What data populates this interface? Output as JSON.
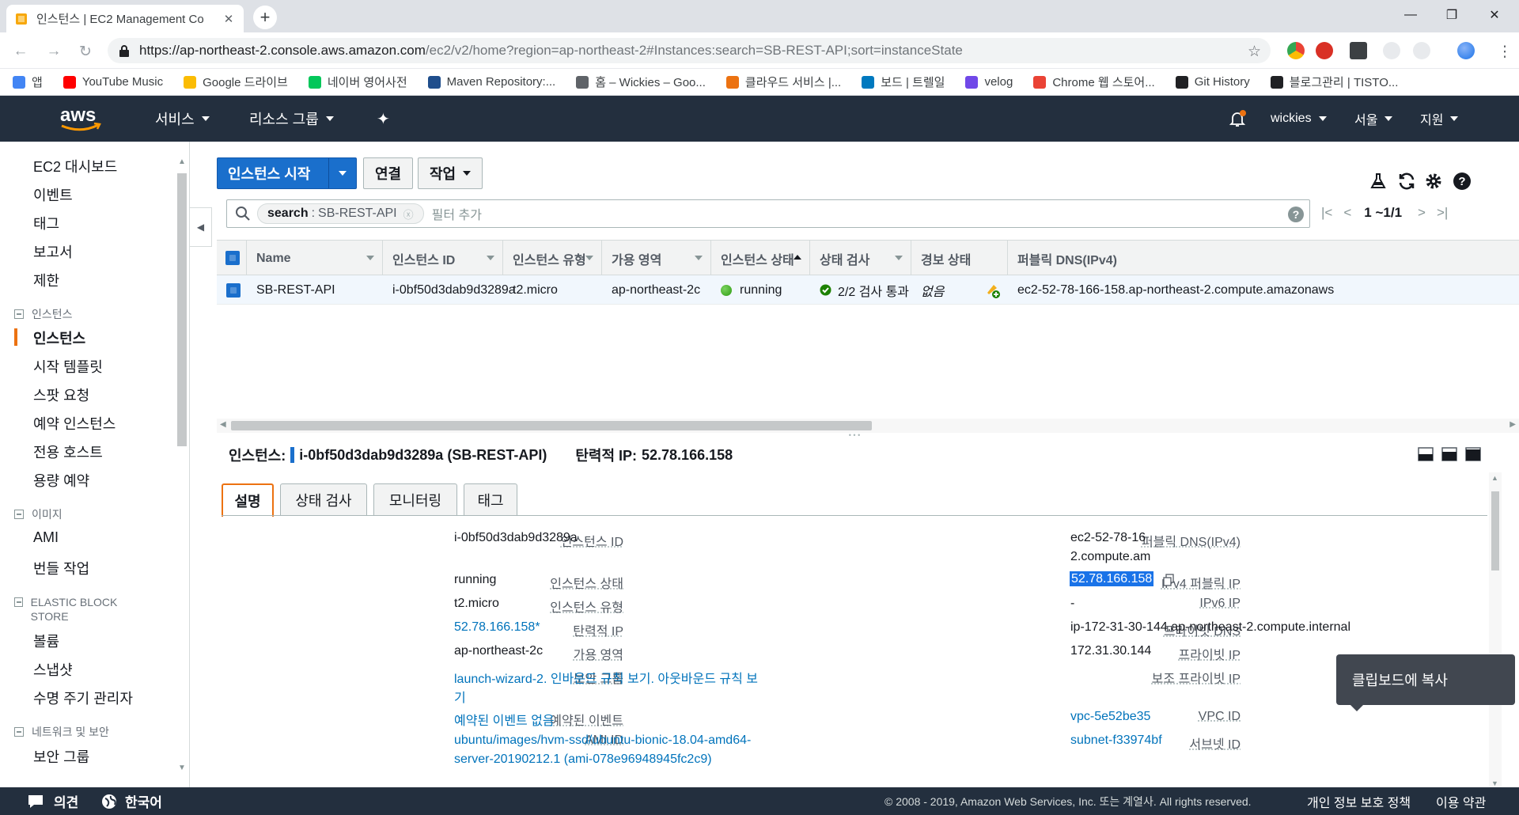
{
  "browser": {
    "tab_title": "인스턴스 | EC2 Management Co",
    "url_host": "https://ap-northeast-2.console.aws.amazon.com",
    "url_path": "/ec2/v2/home?region=ap-northeast-2#Instances:search=SB-REST-API;sort=instanceState",
    "bookmarks": [
      {
        "label": "앱",
        "icon": "apps-grid-icon",
        "color": "#4285f4"
      },
      {
        "label": "YouTube Music",
        "icon": "youtube-music-icon",
        "color": "#ff0000"
      },
      {
        "label": "Google 드라이브",
        "icon": "google-drive-icon",
        "color": "#fbbc04"
      },
      {
        "label": "네이버 영어사전",
        "icon": "naver-dictionary-icon",
        "color": "#03c75a"
      },
      {
        "label": "Maven Repository:...",
        "icon": "maven-icon",
        "color": "#1f4e8c"
      },
      {
        "label": "홈 – Wickies – Goo...",
        "icon": "gear-site-icon",
        "color": "#5f6368"
      },
      {
        "label": "클라우드 서비스 |...",
        "icon": "aws-cube-icon",
        "color": "#ec7211"
      },
      {
        "label": "보드 | 트렐일",
        "icon": "trello-icon",
        "color": "#0079bf"
      },
      {
        "label": "velog",
        "icon": "velog-icon",
        "color": "#7048e8"
      },
      {
        "label": "Chrome 웹 스토어...",
        "icon": "chrome-webstore-icon",
        "color": "#ea4335"
      },
      {
        "label": "Git History",
        "icon": "git-history-icon",
        "color": "#202124"
      },
      {
        "label": "블로그관리 | TISTO...",
        "icon": "tistory-icon",
        "color": "#202124"
      }
    ]
  },
  "aws_header": {
    "logo": "aws",
    "services": "서비스",
    "resource_groups": "리소스 그룹",
    "user": "wickies",
    "region": "서울",
    "support": "지원"
  },
  "sidebar": {
    "items_top": [
      "EC2 대시보드",
      "이벤트",
      "태그",
      "보고서",
      "제한"
    ],
    "section_instances": "인스턴스",
    "items_instances": [
      "인스턴스",
      "시작 템플릿",
      "스팟 요청",
      "예약 인스턴스",
      "전용 호스트",
      "용량 예약"
    ],
    "section_images": "이미지",
    "items_images": [
      "AMI",
      "번들 작업"
    ],
    "section_ebs": "ELASTIC BLOCK STORE",
    "items_ebs": [
      "볼륨",
      "스냅샷",
      "수명 주기 관리자"
    ],
    "section_network": "네트워크 및 보안",
    "items_network": [
      "보안 그룹"
    ]
  },
  "toolbar": {
    "launch": "인스턴스 시작",
    "connect": "연결",
    "actions": "작업"
  },
  "filter": {
    "pill_key": "search",
    "pill_value": "SB-REST-API",
    "placeholder": "필터 추가",
    "page": "1 ~1/1"
  },
  "grid": {
    "columns": [
      "Name",
      "인스턴스 ID",
      "인스턴스 유형",
      "가용 영역",
      "인스턴스 상태",
      "상태 검사",
      "경보 상태",
      "퍼블릭 DNS(IPv4)"
    ],
    "row": {
      "name": "SB-REST-API",
      "id": "i-0bf50d3dab9d3289a",
      "type": "t2.micro",
      "az": "ap-northeast-2c",
      "state": "running",
      "checks": "2/2 검사 통과",
      "alarm": "없음",
      "dns": "ec2-52-78-166-158.ap-northeast-2.compute.amazonaws"
    }
  },
  "detail": {
    "label": "인스턴스:",
    "title": "i-0bf50d3dab9d3289a (SB-REST-API)",
    "eip_label": "탄력적 IP:",
    "eip_value": "52.78.166.158",
    "tabs": [
      "설명",
      "상태 검사",
      "모니터링",
      "태그"
    ],
    "left": [
      {
        "k": "인스턴스 ID",
        "v": "i-0bf50d3dab9d3289a"
      },
      {
        "k": "인스턴스 상태",
        "v": "running"
      },
      {
        "k": "인스턴스 유형",
        "v": "t2.micro"
      },
      {
        "k": "탄력적 IP",
        "v": "52.78.166.158*"
      },
      {
        "k": "가용 영역",
        "v": "ap-northeast-2c"
      },
      {
        "k": "보안 그룹",
        "v": "launch-wizard-2. 인바운드 규칙 보기. 아웃바운드 규칙 보",
        "v2": "기"
      },
      {
        "k": "예약된 이벤트",
        "v": "예약된 이벤트 없음"
      },
      {
        "k": "AMI ID",
        "v": "ubuntu/images/hvm-ssd/ubuntu-bionic-18.04-amd64-",
        "v2": "server-20190212.1 (ami-078e96948945fc2c9)"
      }
    ],
    "right": [
      {
        "k": "퍼블릭 DNS(IPv4)",
        "v": "ec2-52-78-16",
        "v2": "2.compute.am"
      },
      {
        "k": "IPv4 퍼블릭 IP",
        "v": "52.78.166.158"
      },
      {
        "k": "IPv6 IP",
        "v": "-"
      },
      {
        "k": "프라이빗 DNS",
        "v": "ip-172-31-30-144.ap-northeast-2.compute.internal"
      },
      {
        "k": "프라이빗 IP",
        "v": "172.31.30.144"
      },
      {
        "k": "보조 프라이빗 IP",
        "v": ""
      },
      {
        "k": "VPC ID",
        "v": "vpc-5e52be35"
      },
      {
        "k": "서브넷 ID",
        "v": "subnet-f33974bf"
      }
    ],
    "tooltip": "클립보드에 복사"
  },
  "footer": {
    "feedback": "의견",
    "language": "한국어",
    "copyright": "© 2008 - 2019, Amazon Web Services, Inc. 또는 계열사. All rights reserved.",
    "privacy": "개인 정보 보호 정책",
    "terms": "이용 약관"
  },
  "colors": {
    "aws_navy": "#232f3e",
    "primary_blue": "#1a6fcc",
    "accent_orange": "#ec7211",
    "running_green": "#1d8102",
    "link_blue": "#0073bb"
  }
}
